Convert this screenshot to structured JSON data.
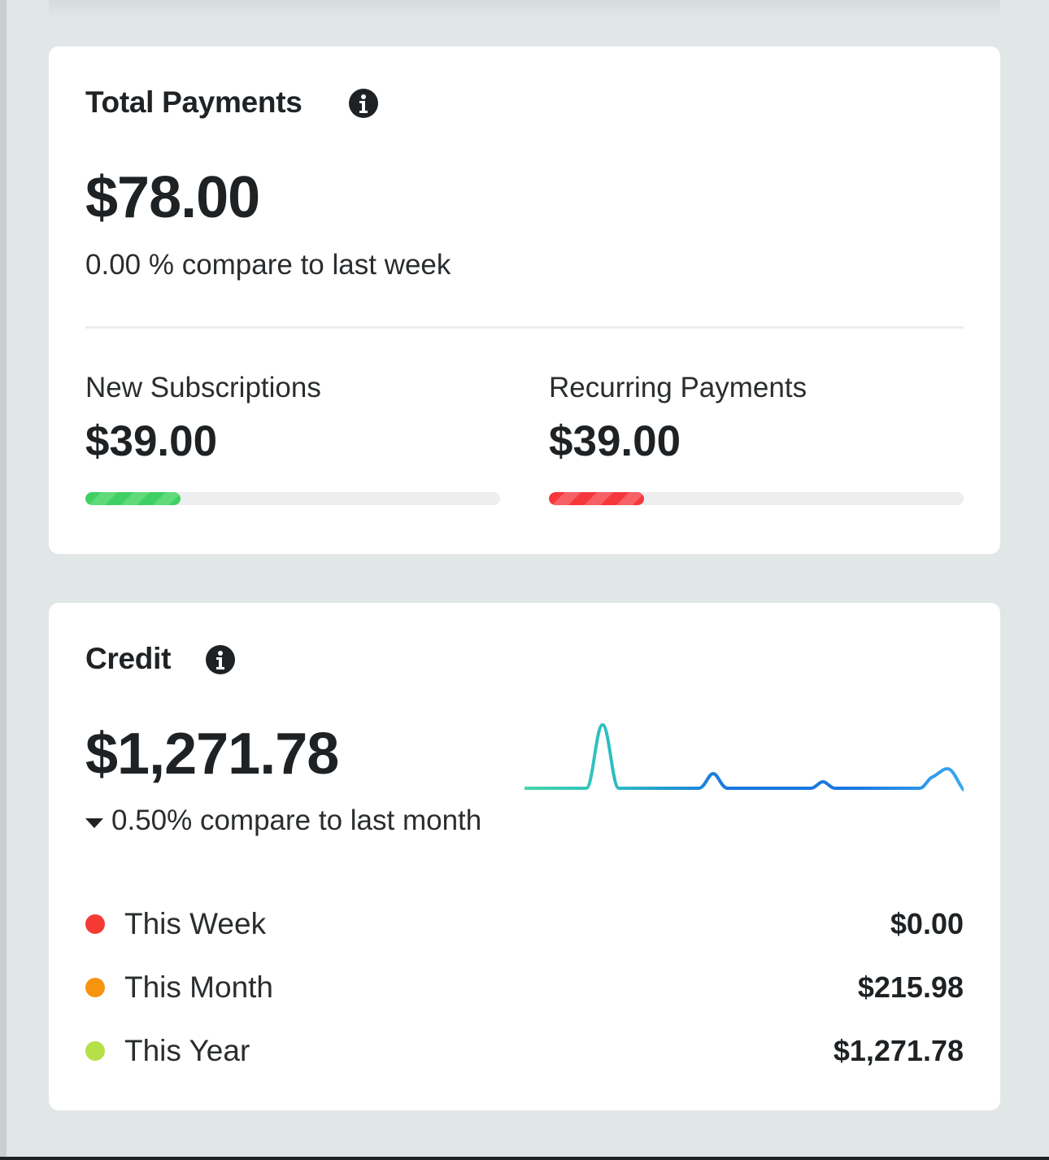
{
  "payments": {
    "title": "Total Payments",
    "info_icon": "info-icon",
    "amount": "$78.00",
    "compare_text": "0.00 % compare to last week",
    "new_subscriptions": {
      "label": "New Subscriptions",
      "amount": "$39.00",
      "progress": 0.23,
      "color": "#3fcf62"
    },
    "recurring_payments": {
      "label": "Recurring Payments",
      "amount": "$39.00",
      "progress": 0.23,
      "color": "#f5373b"
    },
    "sparkline_colors": [
      "#1e6fd9",
      "#5a4fc8"
    ]
  },
  "credit": {
    "title": "Credit",
    "info_icon": "info-icon",
    "amount": "$1,271.78",
    "trend_icon": "caret-down-icon",
    "compare_text": "0.50% compare to last month",
    "sparkline_colors": [
      "#46d6a6",
      "#2cbcc4",
      "#1a78e0",
      "#3aa8f0"
    ],
    "legend": [
      {
        "label": "This Week",
        "value": "$0.00",
        "color": "#f53a33"
      },
      {
        "label": "This Month",
        "value": "$215.98",
        "color": "#f7940f"
      },
      {
        "label": "This Year",
        "value": "$1,271.78",
        "color": "#b5e048"
      }
    ]
  }
}
